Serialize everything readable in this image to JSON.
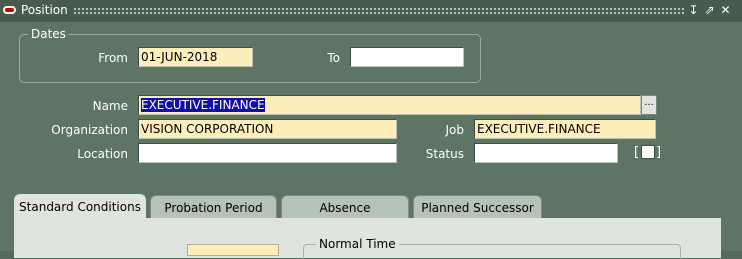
{
  "window": {
    "title": "Position",
    "controls": [
      "minimize-icon",
      "restore-icon",
      "close-icon"
    ]
  },
  "dates": {
    "group_label": "Dates",
    "from_label": "From",
    "from_value": "01-JUN-2018",
    "to_label": "To",
    "to_value": ""
  },
  "details": {
    "name_label": "Name",
    "name_value": "EXECUTIVE.FINANCE",
    "lov_label": "...",
    "organization_label": "Organization",
    "organization_value": "VISION CORPORATION",
    "job_label": "Job",
    "job_value": "EXECUTIVE.FINANCE",
    "location_label": "Location",
    "location_value": "",
    "status_label": "Status",
    "status_value": "",
    "flexfield_open": "[",
    "flexfield_close": "]"
  },
  "tabs": [
    {
      "label": "Standard Conditions",
      "active": true
    },
    {
      "label": "Probation Period",
      "active": false
    },
    {
      "label": "Absence",
      "active": false
    },
    {
      "label": "Planned Successor",
      "active": false
    }
  ],
  "tab_content": {
    "normal_time_label": "Normal Time"
  },
  "colors": {
    "background": "#5e7565",
    "required_field": "#fceebb",
    "selection": "#1010a8"
  }
}
